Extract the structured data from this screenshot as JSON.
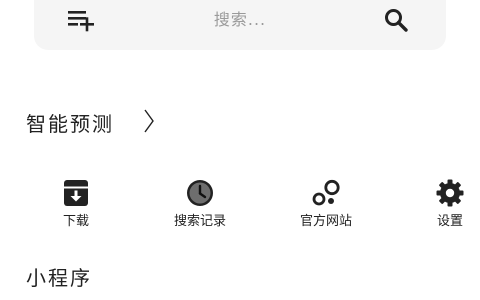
{
  "search": {
    "placeholder": "搜索..."
  },
  "sections": {
    "smart_prediction": "智能预测",
    "mini_programs": "小程序"
  },
  "quick_actions": [
    {
      "label": "下载",
      "icon": "download-box-icon"
    },
    {
      "label": "搜索记录",
      "icon": "clock-icon"
    },
    {
      "label": "官方网站",
      "icon": "bubbles-icon"
    },
    {
      "label": "设置",
      "icon": "gear-icon"
    }
  ],
  "colors": {
    "icon": "#222222",
    "search_bg": "#f5f5f5",
    "placeholder": "#9a9a9a"
  }
}
